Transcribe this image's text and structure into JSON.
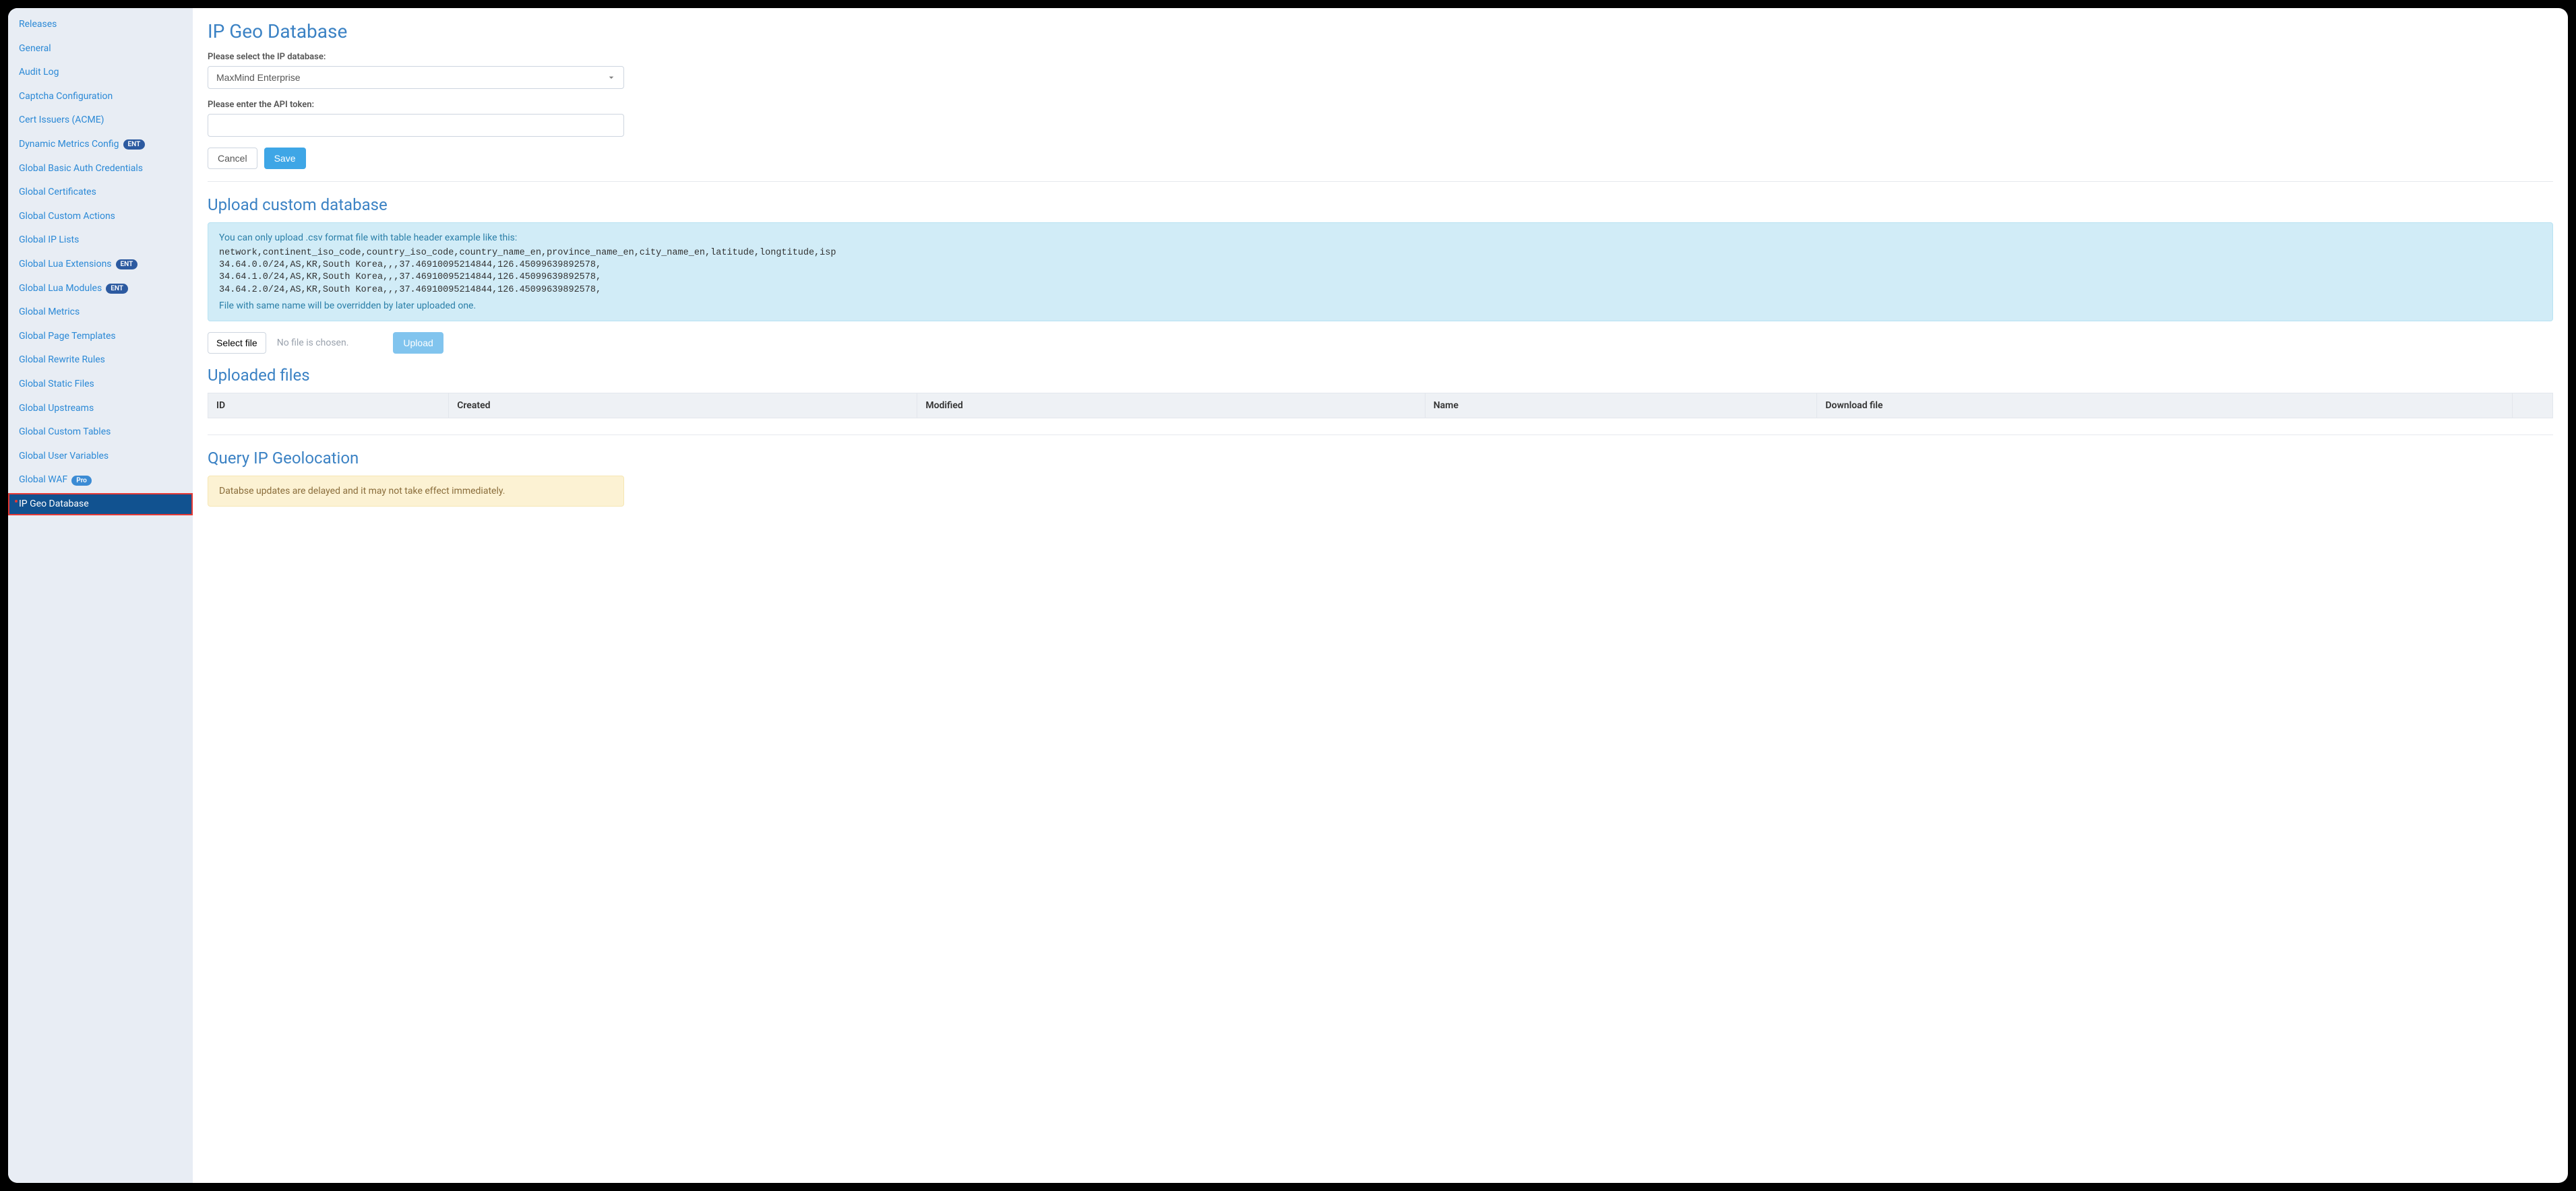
{
  "sidebar": {
    "items": [
      {
        "label": "Releases",
        "badge": null,
        "active": false
      },
      {
        "label": "General",
        "badge": null,
        "active": false
      },
      {
        "label": "Audit Log",
        "badge": null,
        "active": false
      },
      {
        "label": "Captcha Configuration",
        "badge": null,
        "active": false
      },
      {
        "label": "Cert Issuers (ACME)",
        "badge": null,
        "active": false
      },
      {
        "label": "Dynamic Metrics Config",
        "badge": "ENT",
        "active": false
      },
      {
        "label": "Global Basic Auth Credentials",
        "badge": null,
        "active": false
      },
      {
        "label": "Global Certificates",
        "badge": null,
        "active": false
      },
      {
        "label": "Global Custom Actions",
        "badge": null,
        "active": false
      },
      {
        "label": "Global IP Lists",
        "badge": null,
        "active": false
      },
      {
        "label": "Global Lua Extensions",
        "badge": "ENT",
        "active": false
      },
      {
        "label": "Global Lua Modules",
        "badge": "ENT",
        "active": false
      },
      {
        "label": "Global Metrics",
        "badge": null,
        "active": false
      },
      {
        "label": "Global Page Templates",
        "badge": null,
        "active": false
      },
      {
        "label": "Global Rewrite Rules",
        "badge": null,
        "active": false
      },
      {
        "label": "Global Static Files",
        "badge": null,
        "active": false
      },
      {
        "label": "Global Upstreams",
        "badge": null,
        "active": false
      },
      {
        "label": "Global Custom Tables",
        "badge": null,
        "active": false
      },
      {
        "label": "Global User Variables",
        "badge": null,
        "active": false
      },
      {
        "label": "Global WAF",
        "badge": "Pro",
        "active": false
      },
      {
        "label": "IP Geo Database",
        "badge": null,
        "active": true
      }
    ]
  },
  "main": {
    "title": "IP Geo Database",
    "select_label": "Please select the IP database:",
    "select_value": "MaxMind Enterprise",
    "token_label": "Please enter the API token:",
    "token_value": "",
    "cancel_label": "Cancel",
    "save_label": "Save",
    "upload_heading": "Upload custom database",
    "upload_info_line1": "You can only upload .csv format file with table header example like this:",
    "upload_info_code": "network,continent_iso_code,country_iso_code,country_name_en,province_name_en,city_name_en,latitude,longtitude,isp\n34.64.0.0/24,AS,KR,South Korea,,,37.46910095214844,126.45099639892578,\n34.64.1.0/24,AS,KR,South Korea,,,37.46910095214844,126.45099639892578,\n34.64.2.0/24,AS,KR,South Korea,,,37.46910095214844,126.45099639892578,",
    "upload_info_line2": "File with same name will be overridden by later uploaded one.",
    "select_file_label": "Select file",
    "no_file_text": "No file is chosen.",
    "upload_btn_label": "Upload",
    "uploaded_heading": "Uploaded files",
    "table_headers": [
      "ID",
      "Created",
      "Modified",
      "Name",
      "Download file"
    ],
    "query_heading": "Query IP Geolocation",
    "query_warning": "Databse updates are delayed and it may not take effect immediately."
  }
}
